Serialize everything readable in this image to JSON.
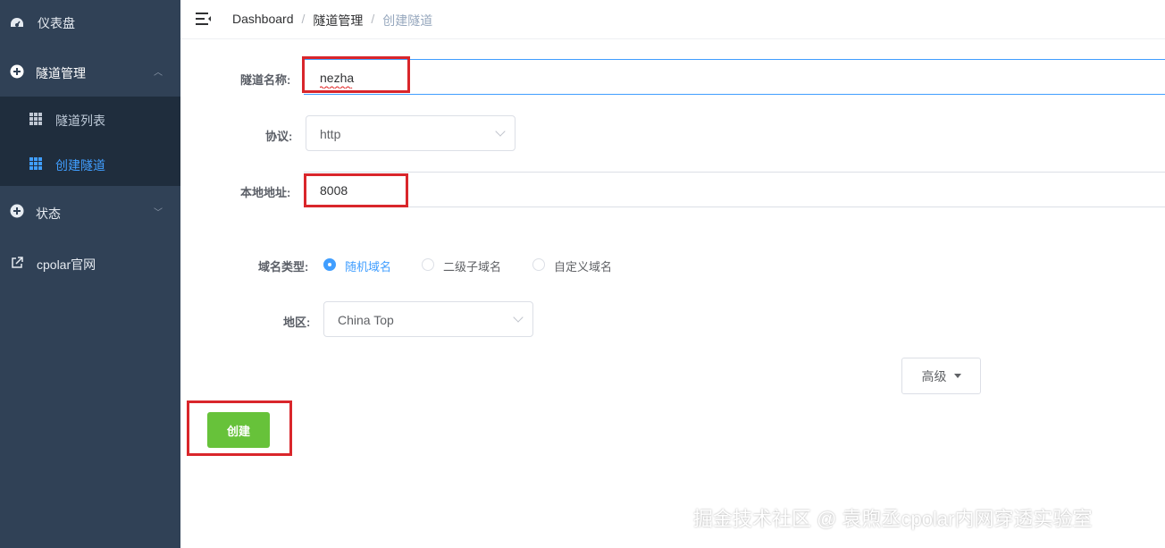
{
  "sidebar": {
    "items": [
      {
        "label": "仪表盘",
        "icon": "dashboard-icon"
      },
      {
        "label": "隧道管理",
        "icon": "plus-circle-icon"
      },
      {
        "label": "隧道列表",
        "icon": "grid-icon"
      },
      {
        "label": "创建隧道",
        "icon": "grid-icon"
      },
      {
        "label": "状态",
        "icon": "plus-circle-icon"
      },
      {
        "label": "cpolar官网",
        "icon": "external-link-icon"
      }
    ],
    "active_color": "#409eff"
  },
  "breadcrumb": [
    "Dashboard",
    "隧道管理",
    "创建隧道"
  ],
  "form": {
    "tunnel_name_label": "隧道名称:",
    "tunnel_name_value": "nezha",
    "protocol_label": "协议:",
    "protocol_value": "http",
    "local_addr_label": "本地地址:",
    "local_addr_value": "8008",
    "domain_type_label": "域名类型:",
    "domain_options": [
      "随机域名",
      "二级子域名",
      "自定义域名"
    ],
    "domain_selected": "随机域名",
    "region_label": "地区:",
    "region_value": "China Top",
    "advanced_label": "高级",
    "create_label": "创建"
  },
  "watermark": "掘金技术社区 @ 袁煦丞cpolar内网穿透实验室",
  "colors": {
    "sidebar_bg": "#304156",
    "submenu_bg": "#1f2d3d",
    "accent": "#409eff",
    "create_button": "#67c23a",
    "highlight_box": "#d9262b"
  }
}
